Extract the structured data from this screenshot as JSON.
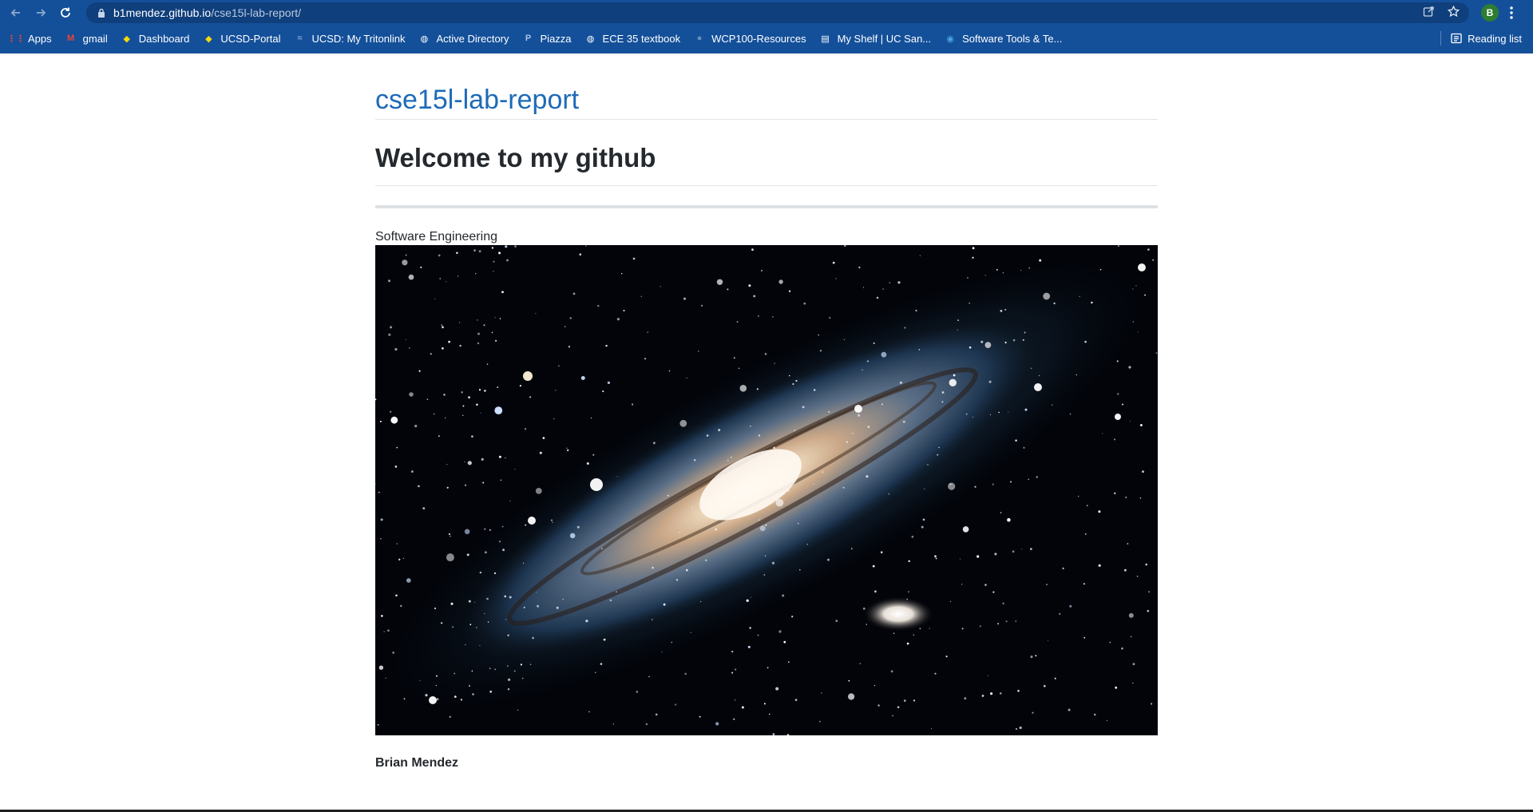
{
  "browser": {
    "url_host": "b1mendez.github.io",
    "url_path": "/cse15l-lab-report/",
    "profile_initial": "B",
    "bookmarks": [
      {
        "label": "Apps",
        "icon": "apps-grid-icon",
        "color": "#e8453c"
      },
      {
        "label": "gmail",
        "icon": "gmail-icon",
        "color": "#ea4335"
      },
      {
        "label": "Dashboard",
        "icon": "canvas-icon",
        "color": "#f5d90a"
      },
      {
        "label": "UCSD-Portal",
        "icon": "canvas-icon",
        "color": "#f5d90a"
      },
      {
        "label": "UCSD: My Tritonlink",
        "icon": "tritonlink-icon",
        "color": "#7fa8d8"
      },
      {
        "label": "Active Directory",
        "icon": "globe-icon",
        "color": "#ffffff"
      },
      {
        "label": "Piazza",
        "icon": "piazza-icon",
        "color": "#a9c1e0"
      },
      {
        "label": "ECE 35 textbook",
        "icon": "globe-icon",
        "color": "#ffffff"
      },
      {
        "label": "WCP100-Resources",
        "icon": "wcp-icon",
        "color": "#6d8fb8"
      },
      {
        "label": "My Shelf | UC San...",
        "icon": "document-icon",
        "color": "#ffffff"
      },
      {
        "label": "Software Tools & Te...",
        "icon": "earth-icon",
        "color": "#4aa3df"
      }
    ],
    "reading_list": "Reading list"
  },
  "page": {
    "site_title": "cse15l-lab-report",
    "heading": "Welcome to my github",
    "image_caption": "Software Engineering",
    "author": "Brian Mendez"
  },
  "colors": {
    "chrome": "#14509a",
    "link": "#1e6bb8",
    "text": "#24292e"
  }
}
